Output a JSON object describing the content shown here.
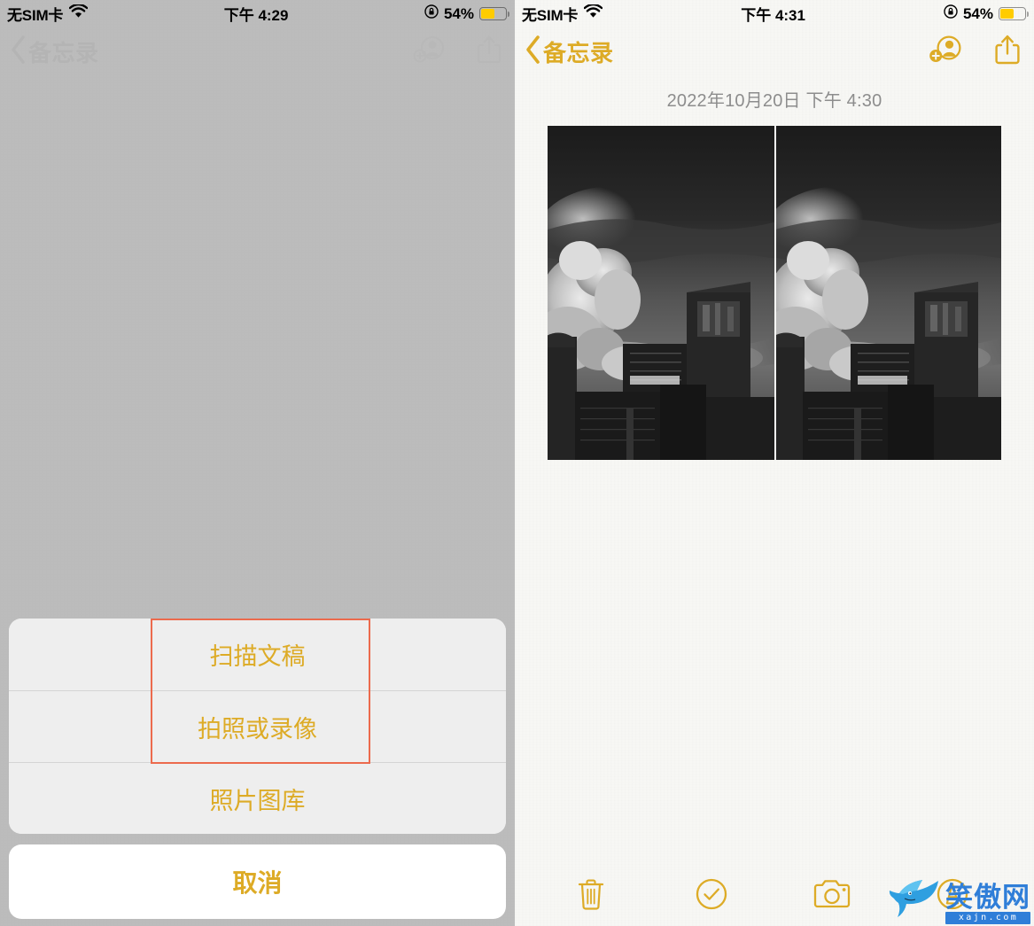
{
  "meta": {
    "accent_color": "#ddab26",
    "dim_color": "#b4b4b4",
    "annotation_color": "#ec6a4d",
    "battery_fill_color": "#ffcc00",
    "note_bg_color": "#f7f7f4",
    "dim_bg_color": "#c7c7c7"
  },
  "left_panel": {
    "status_bar": {
      "carrier": "无SIM卡",
      "wifi_icon": "wifi-icon",
      "time": "下午 4:29",
      "rotation_lock_icon": "rotation-lock-icon",
      "battery_percent": "54%",
      "battery_level": 54,
      "battery_icon": "battery-icon"
    },
    "nav_bar": {
      "back_icon": "chevron-left-icon",
      "back_label": "备忘录",
      "add_person_icon": "add-person-icon",
      "share_icon": "share-icon"
    },
    "action_sheet": {
      "items": [
        {
          "label": "扫描文稿",
          "name": "scan-document"
        },
        {
          "label": "拍照或录像",
          "name": "take-photo-or-video"
        },
        {
          "label": "照片图库",
          "name": "photo-library"
        }
      ],
      "cancel_label": "取消"
    },
    "annotation": {
      "type": "highlight-rectangle",
      "color": "#ec6a4d",
      "targets": [
        "扫描文稿",
        "拍照或录像"
      ]
    }
  },
  "right_panel": {
    "status_bar": {
      "carrier": "无SIM卡",
      "wifi_icon": "wifi-icon",
      "time": "下午 4:31",
      "rotation_lock_icon": "rotation-lock-icon",
      "battery_percent": "54%",
      "battery_level": 54,
      "battery_icon": "battery-icon"
    },
    "nav_bar": {
      "back_icon": "chevron-left-icon",
      "back_label": "备忘录",
      "add_person_icon": "add-person-icon",
      "share_icon": "share-icon"
    },
    "note": {
      "date": "2022年10月20日 下午 4:30",
      "attachments": [
        {
          "name": "note-photo",
          "alt": "黑白城市天际线照片"
        },
        {
          "name": "note-photo",
          "alt": "黑白城市天际线照片"
        }
      ]
    },
    "toolbar": {
      "items": [
        {
          "name": "delete-icon",
          "label": "删除"
        },
        {
          "name": "checklist-icon",
          "label": "核对清单"
        },
        {
          "name": "camera-icon",
          "label": "相机"
        },
        {
          "name": "markup-icon",
          "label": "标记"
        }
      ]
    }
  },
  "watermark": {
    "text": "笑傲网",
    "url": "xajn.com",
    "shark_icon": "shark-logo-icon"
  }
}
